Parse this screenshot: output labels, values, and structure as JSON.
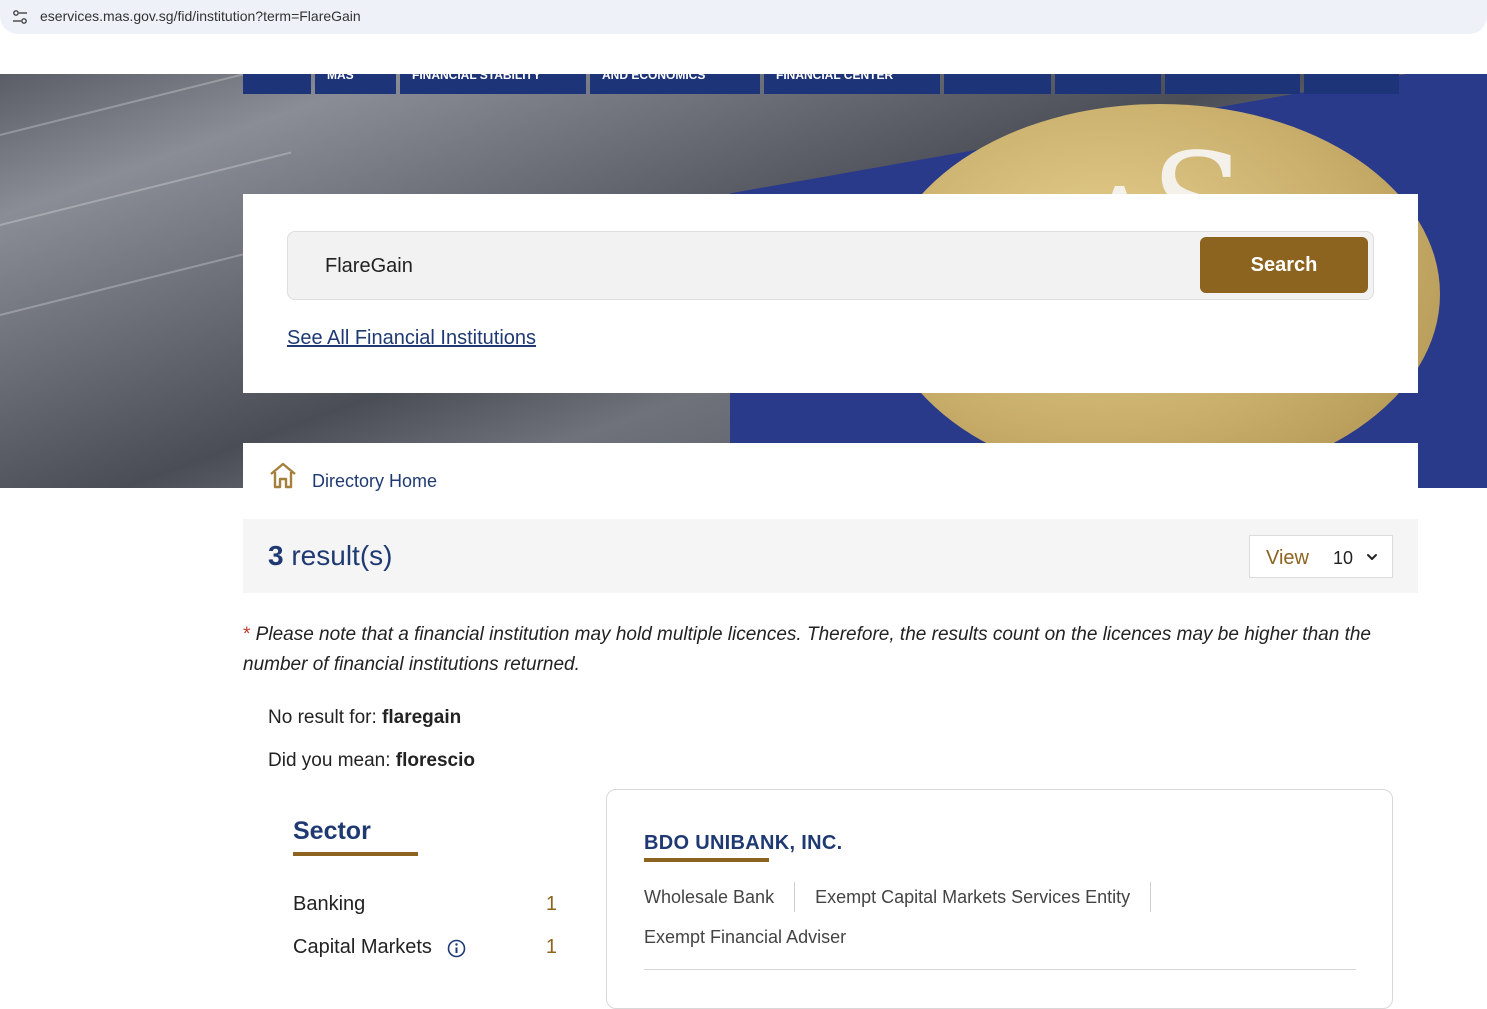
{
  "browser": {
    "url": "eservices.mas.gov.sg/fid/institution?term=FlareGain"
  },
  "top_nav": {
    "items": [
      "MAS",
      "FINANCIAL STABILITY",
      "AND ECONOMICS",
      "FINANCIAL CENTER",
      "",
      "",
      "",
      ""
    ]
  },
  "search": {
    "value": "FlareGain",
    "button_label": "Search",
    "see_all_label": "See All Financial Institutions"
  },
  "breadcrumb": {
    "home_label": "Directory Home"
  },
  "results": {
    "count": "3",
    "count_suffix": " result(s)",
    "view_label": "View",
    "view_value": "10"
  },
  "note": {
    "star": "*",
    "text": " Please note that a financial institution may hold multiple licences. Therefore, the results count on the licences may be higher than the number of financial institutions returned."
  },
  "suggestion": {
    "no_result_prefix": "No result for: ",
    "no_result_term": "flaregain",
    "did_you_mean_prefix": "Did you mean: ",
    "did_you_mean_term": "florescio"
  },
  "sector": {
    "title": "Sector",
    "items": [
      {
        "label": "Banking",
        "count": "1"
      },
      {
        "label": "Capital Markets",
        "count": "1"
      }
    ]
  },
  "result_card": {
    "name": "BDO UNIBANK, INC.",
    "licences": [
      "Wholesale Bank",
      "Exempt Capital Markets Services Entity",
      "Exempt Financial Adviser"
    ]
  },
  "colors": {
    "navy": "#1f3a73",
    "gold": "#8c6420",
    "nav_blue": "#1e3478"
  }
}
